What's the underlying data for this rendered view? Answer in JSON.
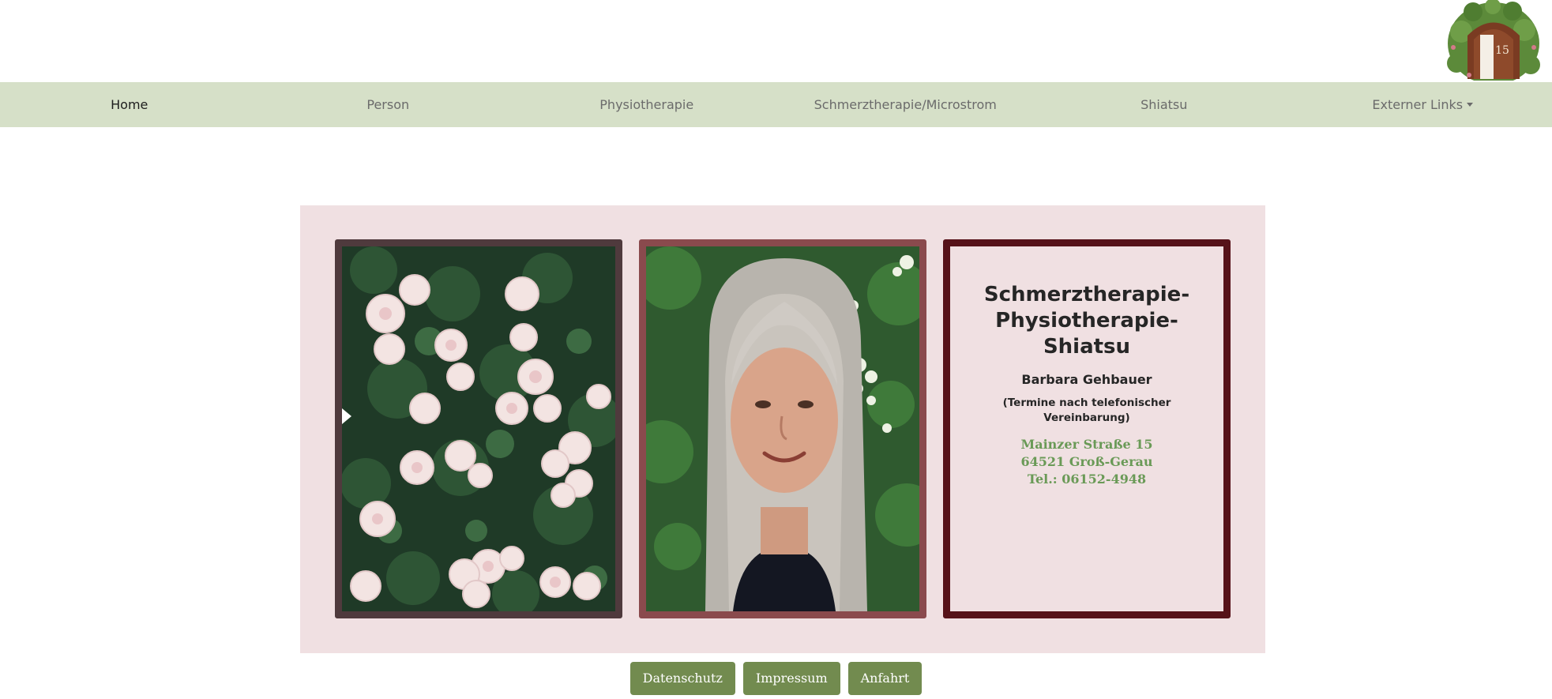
{
  "header": {
    "logo_number": "15"
  },
  "nav": {
    "items": [
      {
        "label": "Home",
        "active": true
      },
      {
        "label": "Person",
        "active": false
      },
      {
        "label": "Physiotherapie",
        "active": false
      },
      {
        "label": "Schmerztherapie/Microstrom",
        "active": false
      },
      {
        "label": "Shiatsu",
        "active": false
      },
      {
        "label": "Externer Links",
        "active": false,
        "dropdown": true
      }
    ]
  },
  "info_card": {
    "title": "Schmerztherapie-Physiotherapie-Shiatsu",
    "name": "Barbara Gehbauer",
    "note": "(Termine nach telefonischer Vereinbarung)",
    "address_street": "Mainzer Straße 15",
    "address_city": "64521 Groß-Gerau",
    "phone": "Tel.: 06152-4948"
  },
  "footer": {
    "privacy_label": "Datenschutz",
    "imprint_label": "Impressum",
    "directions_label": "Anfahrt"
  },
  "colors": {
    "nav_background": "#d6e0c8",
    "panel_background": "#f0e0e2",
    "address_text": "#6a9a57",
    "button_background": "#728b4f",
    "card_border_roses": "#4f3a3d",
    "card_border_portrait": "#8a4a4d",
    "card_border_info": "#561219"
  },
  "icons": {
    "logo": "garden-door-icon",
    "dropdown": "caret-down-icon"
  }
}
